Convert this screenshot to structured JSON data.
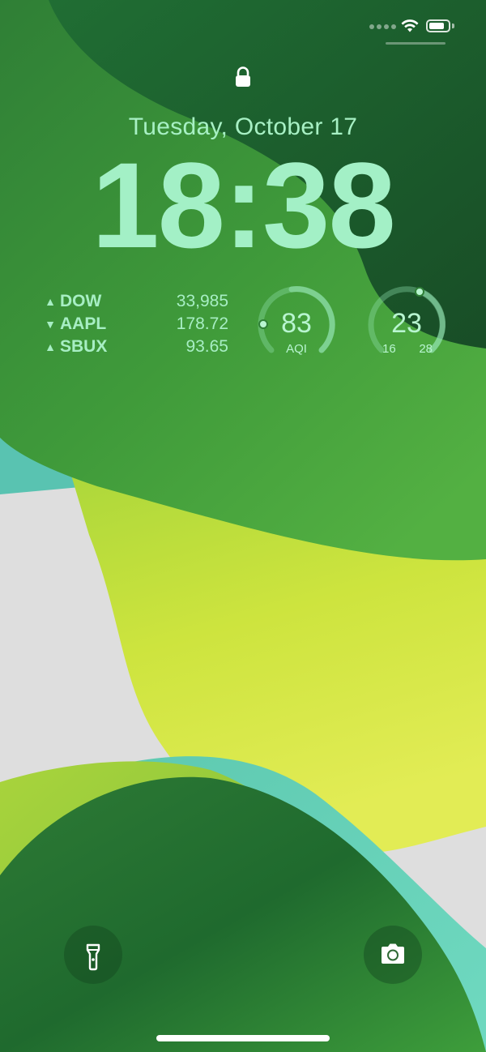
{
  "lockscreen": {
    "date": "Tuesday, October 17",
    "time": "18:38"
  },
  "stocks": [
    {
      "symbol": "DOW",
      "value": "33,985",
      "direction": "up",
      "arrow": "▲"
    },
    {
      "symbol": "AAPL",
      "value": "178.72",
      "direction": "down",
      "arrow": "▼"
    },
    {
      "symbol": "SBUX",
      "value": "93.65",
      "direction": "up",
      "arrow": "▲"
    }
  ],
  "aqi_widget": {
    "value": "83",
    "label": "AQI"
  },
  "temperature_widget": {
    "current": "23",
    "low": "16",
    "high": "28"
  },
  "icons": {
    "lock": "lock-icon",
    "wifi": "wifi-icon",
    "battery": "battery-icon",
    "flashlight": "flashlight-icon",
    "camera": "camera-icon"
  },
  "colors": {
    "text_accent": "#a7f0c4",
    "wallpaper_dark": "#1b5e2a",
    "wallpaper_lime": "#c6e43e",
    "wallpaper_teal": "#4ec9a6"
  }
}
